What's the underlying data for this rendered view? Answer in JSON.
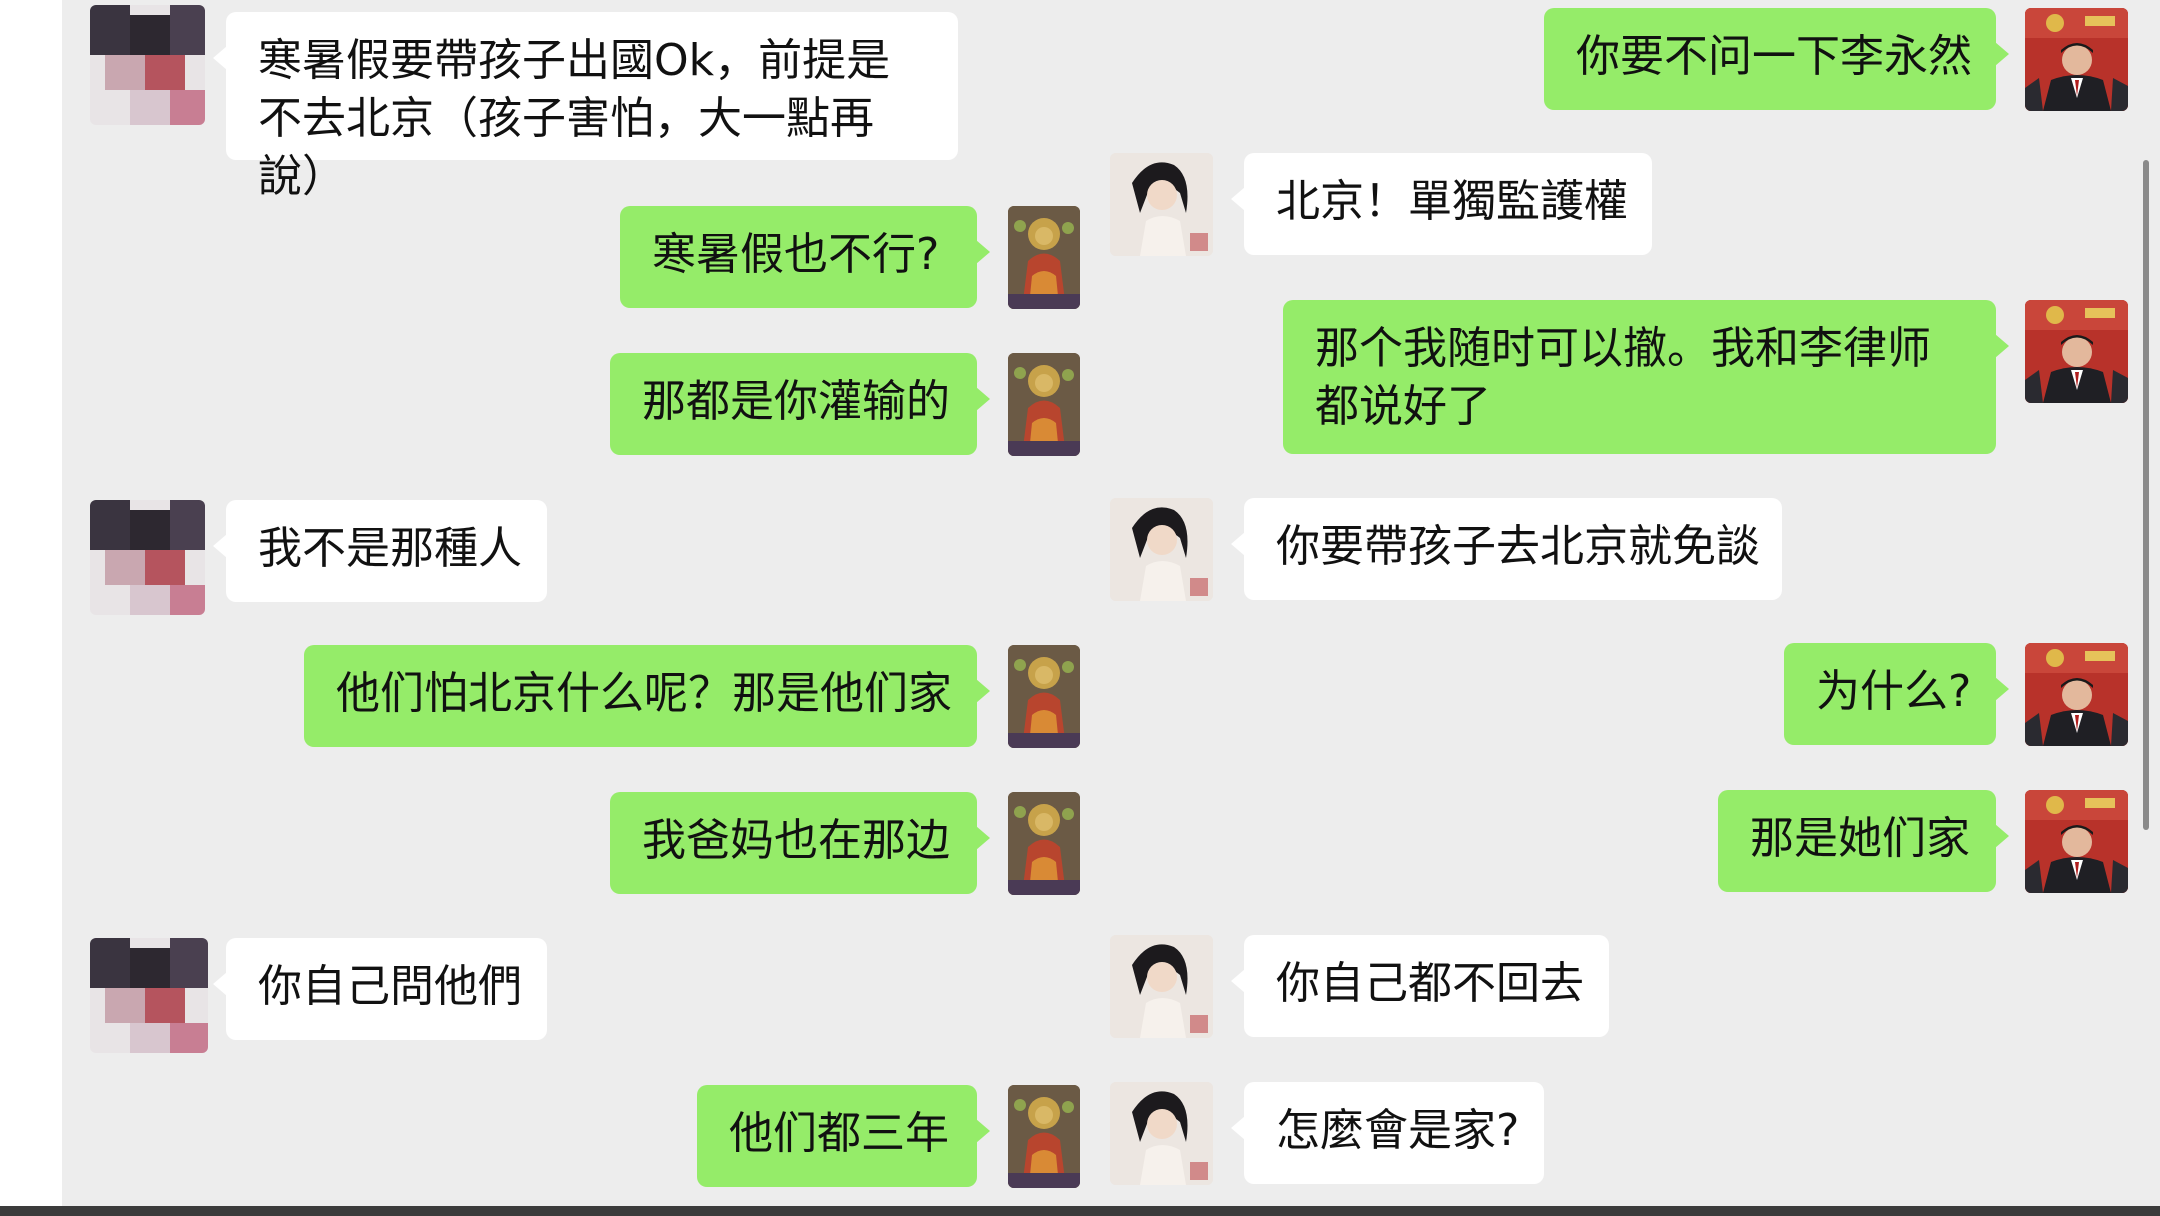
{
  "colors": {
    "background": "#ededed",
    "bubble_green": "#95ec69",
    "bubble_white": "#ffffff"
  },
  "left_panel": {
    "messages": [
      {
        "side": "incoming",
        "text": "寒暑假要帶孩子出國Ok，前提是不去北京（孩子害怕，大一點再說）",
        "avatar": "pixelated-avatar"
      },
      {
        "side": "outgoing",
        "text": "寒暑假也不行?",
        "avatar": "buddha-avatar"
      },
      {
        "side": "outgoing",
        "text": "那都是你灌输的",
        "avatar": "buddha-avatar"
      },
      {
        "side": "incoming",
        "text": "我不是那種人",
        "avatar": "pixelated-avatar"
      },
      {
        "side": "outgoing",
        "text": "他们怕北京什么呢？那是他们家",
        "avatar": "buddha-avatar"
      },
      {
        "side": "outgoing",
        "text": "我爸妈也在那边",
        "avatar": "buddha-avatar"
      },
      {
        "side": "incoming",
        "text": "你自己問他們",
        "avatar": "pixelated-avatar"
      },
      {
        "side": "outgoing",
        "text": "他们都三年",
        "avatar": "buddha-avatar"
      }
    ]
  },
  "right_panel": {
    "messages": [
      {
        "side": "outgoing",
        "text": "你要不问一下李永然",
        "avatar": "official-avatar"
      },
      {
        "side": "incoming",
        "text": "北京！單獨監護權",
        "avatar": "woman-avatar"
      },
      {
        "side": "outgoing",
        "text": "那个我随时可以撤。我和李律师都说好了",
        "avatar": "official-avatar"
      },
      {
        "side": "incoming",
        "text": "你要帶孩子去北京就免談",
        "avatar": "woman-avatar"
      },
      {
        "side": "outgoing",
        "text": "为什么?",
        "avatar": "official-avatar"
      },
      {
        "side": "outgoing",
        "text": "那是她们家",
        "avatar": "official-avatar"
      },
      {
        "side": "incoming",
        "text": "你自己都不回去",
        "avatar": "woman-avatar"
      },
      {
        "side": "incoming",
        "text": "怎麼會是家?",
        "avatar": "woman-avatar"
      }
    ]
  }
}
